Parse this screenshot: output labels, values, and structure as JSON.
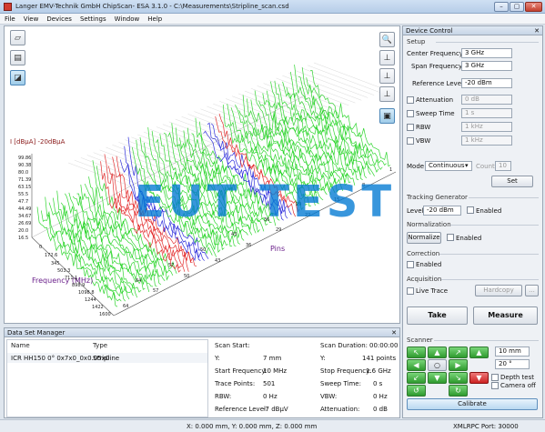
{
  "window": {
    "title": "Langer EMV-Technik GmbH ChipScan- ESA 3.1.0 - C:\\Measurements\\Stripline_scan.csd",
    "min": "–",
    "max": "▢",
    "close": "✕"
  },
  "menu": [
    "File",
    "View",
    "Devices",
    "Settings",
    "Window",
    "Help"
  ],
  "plot": {
    "y_label": "I [dBµA] -20dBµA",
    "pins_label": "Pins",
    "freq_label": "Frequency (MHz)",
    "level_ticks": [
      "99.86",
      "90.38",
      "80.0",
      "71.39",
      "63.15",
      "55.5",
      "47.7",
      "44.49",
      "34.67",
      "26.69",
      "20.0",
      "16.5"
    ],
    "freq_ticks": [
      "0",
      "172.6",
      "345",
      "503.3",
      "711.1",
      "898.9",
      "1098.8",
      "1244",
      "1422",
      "1600"
    ],
    "pin_ticks": [
      "64",
      "57",
      "50",
      "43",
      "36",
      "29",
      "22",
      "15",
      "8",
      "1"
    ],
    "pin_ticks_b": [
      "64",
      "57",
      "50",
      "43",
      "36",
      "29"
    ],
    "colors": {
      "green": "#19d219",
      "red": "#e01818",
      "blue": "#1818d8"
    }
  },
  "device_control": {
    "title": "Device Control",
    "setup_label": "Setup",
    "center_frequency_label": "Center Frequency",
    "center_frequency": "3 GHz",
    "span_frequency_label": "Span Frequency",
    "span_frequency": "3 GHz",
    "reference_level_label": "Reference Level",
    "reference_level": "-20 dBm",
    "attenuation_label": "Attenuation",
    "attenuation": "0 dB",
    "sweep_time_label": "Sweep Time",
    "sweep_time": "1 s",
    "rbw_label": "RBW",
    "rbw": "1 kHz",
    "vbw_label": "VBW",
    "vbw": "1 kHz",
    "mode_label": "Mode",
    "mode": "Continuous",
    "count_label": "Count",
    "count": "10",
    "set_label": "Set",
    "tracking_label": "Tracking Generator",
    "level_label": "Level",
    "tracking_level": "-20 dBm",
    "enabled_label": "Enabled",
    "normalization_label": "Normalization",
    "normalize_label": "Normalize",
    "correction_label": "Correction",
    "acquisition_label": "Acquisition",
    "live_trace_label": "Live Trace",
    "hardcopy_label": "Hardcopy",
    "more_label": "...",
    "take_label": "Take",
    "measure_label": "Measure",
    "scanner_label": "Scanner",
    "step_distance": "10 mm",
    "step_angle": "20 °",
    "depth_test_label": "Depth test",
    "camera_off_label": "Camera off",
    "calibrate_label": "Calibrate"
  },
  "dsm": {
    "title": "Data Set Manager",
    "col_name": "Name",
    "col_type": "Type",
    "rows": [
      {
        "name": "ICR HH150 0° 0x7x0_0x0.05x0",
        "type": "Stripline"
      }
    ],
    "info_left": [
      {
        "k": "Scan Start:",
        "v": ""
      },
      {
        "k": "Y:",
        "v": "7 mm"
      },
      {
        "k": "Start Frequency:",
        "v": "10 MHz"
      },
      {
        "k": "Trace Points:",
        "v": "501"
      },
      {
        "k": "RBW:",
        "v": "0 Hz"
      },
      {
        "k": "Reference Level:",
        "v": "-7 dBµV"
      }
    ],
    "info_right": [
      {
        "k": "Scan Duration:",
        "v": "00:00:00"
      },
      {
        "k": "Y:",
        "v": "141 points"
      },
      {
        "k": "Stop Frequency:",
        "v": "1.6 GHz"
      },
      {
        "k": "Sweep Time:",
        "v": "0 s"
      },
      {
        "k": "VBW:",
        "v": "0 Hz"
      },
      {
        "k": "Attenuation:",
        "v": "0 dB"
      }
    ]
  },
  "status": {
    "coords": "X: 0.000 mm, Y: 0.000 mm, Z: 0.000 mm",
    "port": "XMLRPC Port: 30000"
  },
  "watermark": "EUT TEST"
}
